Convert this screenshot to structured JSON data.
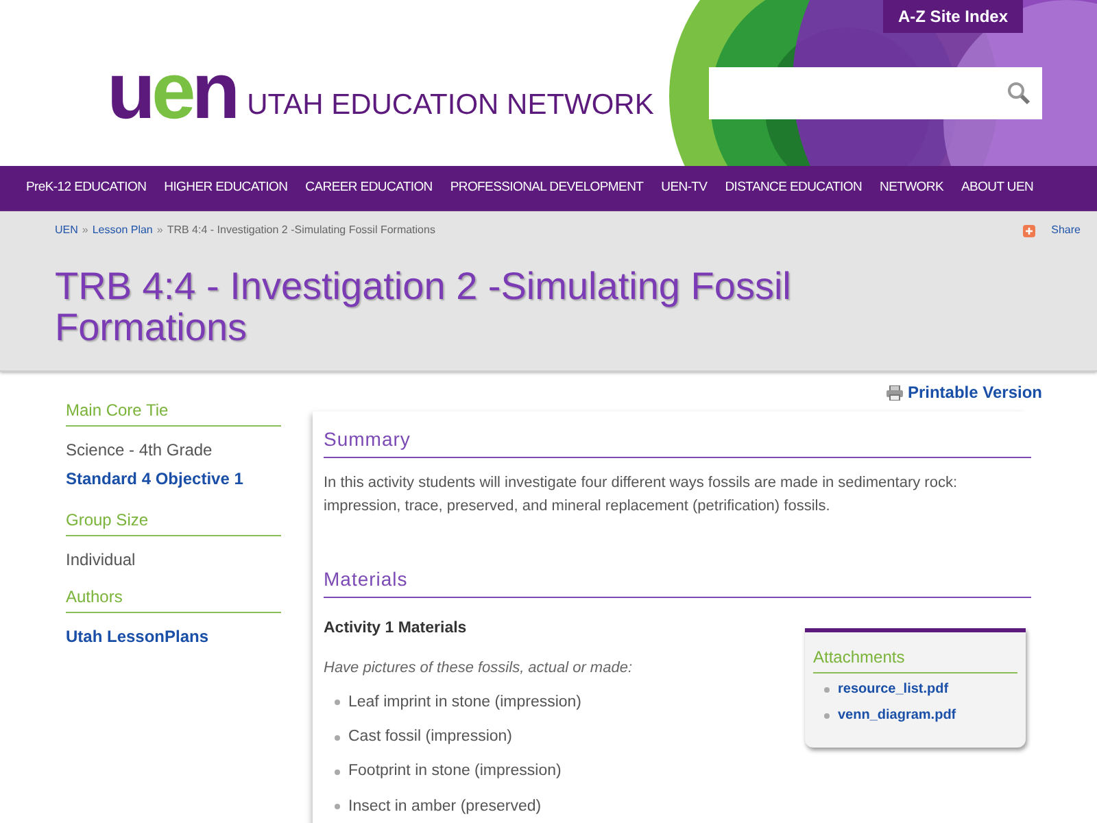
{
  "header": {
    "logo_letters": [
      {
        "text": "u",
        "color": "#5c1a7d"
      },
      {
        "text": "e",
        "color": "#7ac143"
      },
      {
        "text": "n",
        "color": "#5c1a7d"
      }
    ],
    "site_name": "UTAH EDUCATION NETWORK",
    "site_index": "A-Z Site Index"
  },
  "nav": [
    "PreK-12 EDUCATION",
    "HIGHER EDUCATION",
    "CAREER EDUCATION",
    "PROFESSIONAL DEVELOPMENT",
    "UEN-TV",
    "DISTANCE EDUCATION",
    "NETWORK",
    "ABOUT UEN"
  ],
  "breadcrumb": {
    "links": [
      "UEN",
      "Lesson Plan"
    ],
    "separator": "»",
    "current": "TRB 4:4 - Investigation 2 -Simulating Fossil Formations"
  },
  "share": "Share",
  "title": "TRB 4:4 - Investigation 2 -Simulating Fossil Formations",
  "sidebar": [
    {
      "heading": "Main Core Tie",
      "items": [
        {
          "text": "Science - 4th Grade",
          "kind": "text"
        },
        {
          "text": "Standard 4 Objective 1",
          "kind": "link"
        }
      ]
    },
    {
      "heading": "Group Size",
      "items": [
        {
          "text": "Individual",
          "kind": "text"
        }
      ]
    },
    {
      "heading": "Authors",
      "items": [
        {
          "text": "Utah LessonPlans",
          "kind": "link"
        }
      ]
    }
  ],
  "printable": "Printable Version",
  "summary": {
    "heading": "Summary",
    "text": "In this activity students will investigate four different ways fossils are made in sedimentary rock: impression, trace, preserved, and mineral replacement (petrification) fossils."
  },
  "materials": {
    "heading": "Materials",
    "subheading": "Activity 1 Materials",
    "intro": "Have pictures of these fossils, actual or made:",
    "items": [
      "Leaf imprint in stone (impression)",
      "Cast fossil (impression)",
      "Footprint in stone (impression)",
      "Insect in amber (preserved)"
    ]
  },
  "attachments": {
    "heading": "Attachments",
    "files": [
      "resource_list.pdf",
      "venn_diagram.pdf"
    ]
  }
}
